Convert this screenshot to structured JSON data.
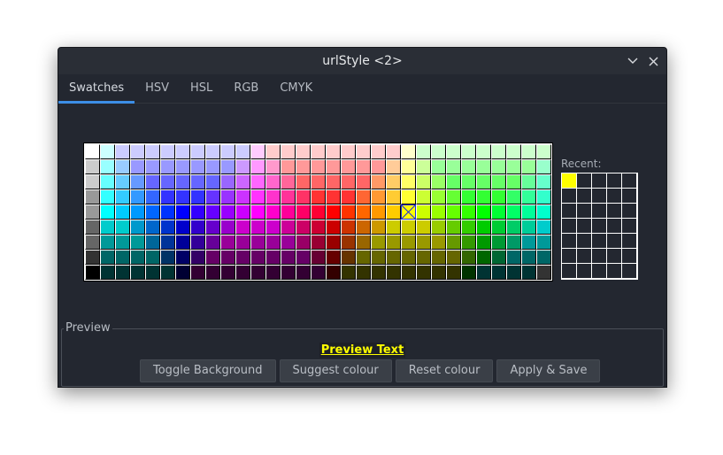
{
  "window": {
    "title": "urlStyle <2>",
    "minimize_icon": "chevron-down-icon",
    "close_icon": "close-icon"
  },
  "tabs": [
    {
      "label": "Swatches",
      "active": true
    },
    {
      "label": "HSV",
      "active": false
    },
    {
      "label": "HSL",
      "active": false
    },
    {
      "label": "RGB",
      "active": false
    },
    {
      "label": "CMYK",
      "active": false
    }
  ],
  "palette": {
    "selected": {
      "row": 4,
      "col": 21
    },
    "rows": [
      [
        "#ffffff",
        "#ccffff",
        "#ccccff",
        "#ccccff",
        "#ccccff",
        "#ccccff",
        "#ccccff",
        "#ccccff",
        "#ccccff",
        "#ccccff",
        "#ccccff",
        "#ffccff",
        "#ffcccc",
        "#ffcccc",
        "#ffcccc",
        "#ffcccc",
        "#ffcccc",
        "#ffcccc",
        "#ffcccc",
        "#ffcccc",
        "#ffcccc",
        "#ffffcc",
        "#ccffcc",
        "#ccffcc",
        "#ccffcc",
        "#ccffcc",
        "#ccffcc",
        "#ccffcc",
        "#ccffcc",
        "#ccffcc",
        "#ccffcc"
      ],
      [
        "#cccccc",
        "#99ffff",
        "#99ccff",
        "#9999ff",
        "#9999ff",
        "#9999ff",
        "#9999ff",
        "#9999ff",
        "#9999ff",
        "#9999ff",
        "#cc99ff",
        "#ff99ff",
        "#ff99cc",
        "#ff9999",
        "#ff9999",
        "#ff9999",
        "#ff9999",
        "#ff9999",
        "#ff9999",
        "#ff9999",
        "#ffcc99",
        "#ffff99",
        "#ccff99",
        "#99ff99",
        "#99ff99",
        "#99ff99",
        "#99ff99",
        "#99ff99",
        "#99ff99",
        "#99ff99",
        "#99ffcc"
      ],
      [
        "#cccccc",
        "#66ffff",
        "#66ccff",
        "#6699ff",
        "#6666ff",
        "#6666ff",
        "#6666ff",
        "#6666ff",
        "#6666ff",
        "#9966ff",
        "#cc66ff",
        "#ff66ff",
        "#ff66cc",
        "#ff6699",
        "#ff6666",
        "#ff6666",
        "#ff6666",
        "#ff6666",
        "#ff6666",
        "#ff9966",
        "#ffcc66",
        "#ffff66",
        "#ccff66",
        "#99ff66",
        "#66ff66",
        "#66ff66",
        "#66ff66",
        "#66ff66",
        "#66ff66",
        "#66ff99",
        "#66ffcc"
      ],
      [
        "#999999",
        "#33ffff",
        "#33ccff",
        "#3399ff",
        "#3366ff",
        "#3333ff",
        "#3333ff",
        "#3333ff",
        "#6633ff",
        "#9933ff",
        "#cc33ff",
        "#ff33ff",
        "#ff33cc",
        "#ff3399",
        "#ff3366",
        "#ff3333",
        "#ff3333",
        "#ff3333",
        "#ff6633",
        "#ff9933",
        "#ffcc33",
        "#ffff33",
        "#ccff33",
        "#99ff33",
        "#66ff33",
        "#33ff33",
        "#33ff33",
        "#33ff33",
        "#33ff66",
        "#33ff99",
        "#33ffcc"
      ],
      [
        "#999999",
        "#00ffff",
        "#00ccff",
        "#0099ff",
        "#0066ff",
        "#0033ff",
        "#0000ff",
        "#3300ff",
        "#6600ff",
        "#9900ff",
        "#cc00ff",
        "#ff00ff",
        "#ff00cc",
        "#ff0099",
        "#ff0066",
        "#ff0033",
        "#ff0000",
        "#ff3300",
        "#ff6600",
        "#ff9900",
        "#ffcc00",
        "#ffff00",
        "#ccff00",
        "#99ff00",
        "#66ff00",
        "#33ff00",
        "#00ff00",
        "#00ff33",
        "#00ff66",
        "#00ff99",
        "#00ffcc"
      ],
      [
        "#666666",
        "#00cccc",
        "#00cccc",
        "#0099cc",
        "#0066cc",
        "#0033cc",
        "#0000cc",
        "#3300cc",
        "#6600cc",
        "#9900cc",
        "#cc00cc",
        "#cc00cc",
        "#cc00cc",
        "#cc0099",
        "#cc0066",
        "#cc0033",
        "#cc0000",
        "#cc3300",
        "#cc6600",
        "#cc9900",
        "#cccc00",
        "#cccc00",
        "#cccc00",
        "#99cc00",
        "#66cc00",
        "#33cc00",
        "#00cc00",
        "#00cc33",
        "#00cc66",
        "#00cc99",
        "#00cccc"
      ],
      [
        "#666666",
        "#009999",
        "#009999",
        "#009999",
        "#006699",
        "#003399",
        "#000099",
        "#330099",
        "#660099",
        "#990099",
        "#990099",
        "#990099",
        "#990099",
        "#990099",
        "#990066",
        "#990033",
        "#990000",
        "#993300",
        "#996600",
        "#999900",
        "#999900",
        "#999900",
        "#999900",
        "#999900",
        "#669900",
        "#339900",
        "#009900",
        "#009933",
        "#009966",
        "#009999",
        "#009999"
      ],
      [
        "#333333",
        "#006666",
        "#006666",
        "#006666",
        "#006666",
        "#003366",
        "#000066",
        "#330066",
        "#660066",
        "#660066",
        "#660066",
        "#660066",
        "#660066",
        "#660066",
        "#660066",
        "#660033",
        "#660000",
        "#663300",
        "#666600",
        "#666600",
        "#666600",
        "#666600",
        "#666600",
        "#666600",
        "#666600",
        "#336600",
        "#006600",
        "#006633",
        "#006666",
        "#006666",
        "#006666"
      ],
      [
        "#000000",
        "#003333",
        "#003333",
        "#003333",
        "#003333",
        "#003333",
        "#000033",
        "#330033",
        "#330033",
        "#330033",
        "#330033",
        "#330033",
        "#330033",
        "#330033",
        "#330033",
        "#330033",
        "#330000",
        "#333300",
        "#333300",
        "#333300",
        "#333300",
        "#333300",
        "#333300",
        "#333300",
        "#333300",
        "#003300",
        "#003333",
        "#003333",
        "#003333",
        "#003333",
        "#333333"
      ]
    ]
  },
  "recent": {
    "label": "Recent:",
    "columns": 5,
    "rows": 7,
    "colors": [
      "#ffff00"
    ]
  },
  "preview": {
    "legend": "Preview",
    "text": "Preview Text",
    "text_color": "#ffff00"
  },
  "buttons": {
    "toggle_background": "Toggle Background",
    "suggest_colour": "Suggest colour",
    "reset_colour": "Reset colour",
    "apply_save": "Apply & Save"
  }
}
